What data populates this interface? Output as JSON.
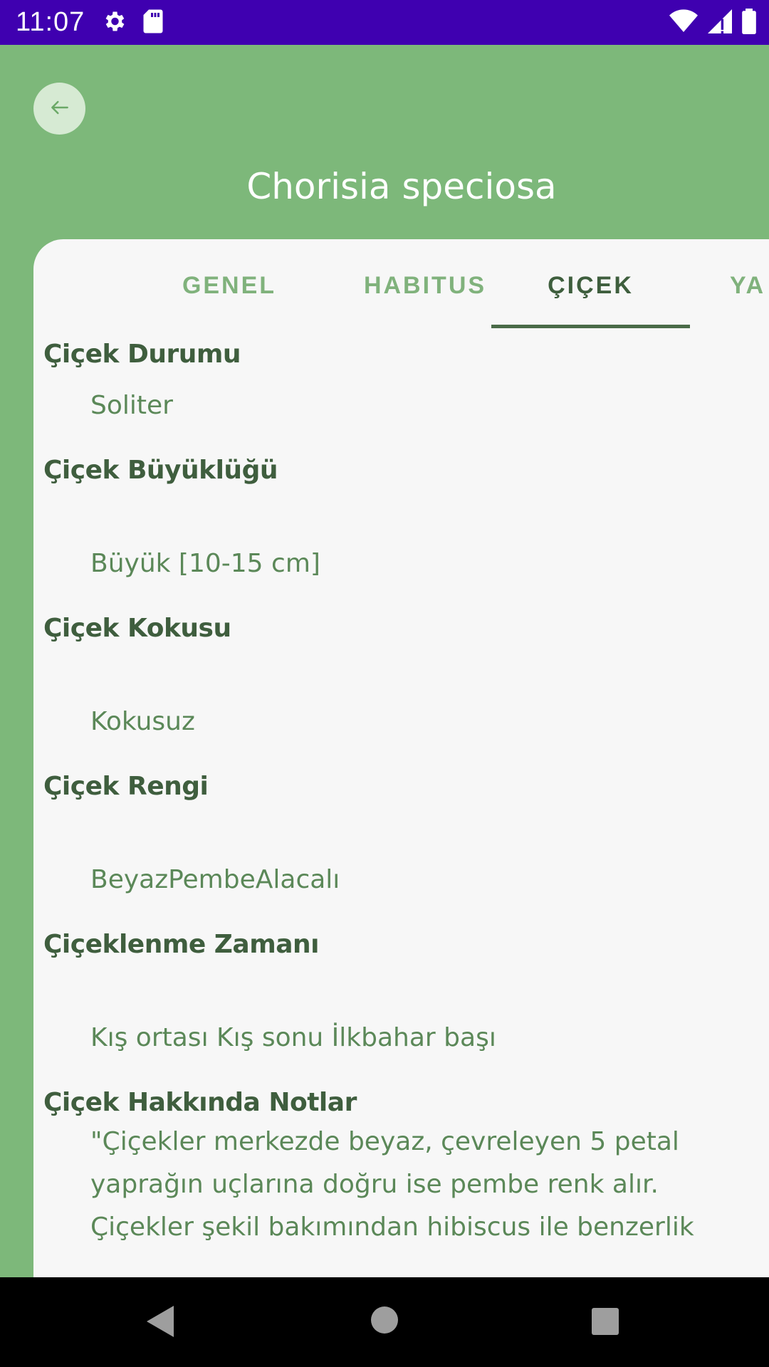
{
  "status_bar": {
    "time": "11:07",
    "left_icons": [
      "gear-icon",
      "sd-card-icon"
    ],
    "right_icons": [
      "wifi-icon",
      "signal-icon",
      "battery-icon"
    ]
  },
  "header": {
    "back_icon": "arrow-left-icon",
    "title": "Chorisia speciosa"
  },
  "tabs": [
    {
      "label": "GENEL",
      "active": false
    },
    {
      "label": "HABITUS",
      "active": false
    },
    {
      "label": "ÇIÇEK",
      "active": true
    },
    {
      "label": "YA",
      "active": false
    }
  ],
  "sections": [
    {
      "label": "Çiçek Durumu",
      "value": "Soliter"
    },
    {
      "label": "Çiçek Büyüklüğü",
      "value": "Büyük [10-15 cm]"
    },
    {
      "label": "Çiçek Kokusu",
      "value": "Kokusuz"
    },
    {
      "label": "Çiçek Rengi",
      "value": "BeyazPembeAlacalı"
    },
    {
      "label": "Çiçeklenme Zamanı",
      "value": " Kış ortası Kış sonu İlkbahar başı"
    },
    {
      "label": "Çiçek Hakkında Notlar",
      "value": "\"Çiçekler merkezde beyaz, çevreleyen 5 petal yaprağın uçlarına doğru ise pembe renk alır. Çiçekler şekil bakımından hibiscus ile benzerlik"
    }
  ],
  "nav_bar": {
    "icons": [
      "back-triangle-icon",
      "home-circle-icon",
      "recents-square-icon"
    ]
  },
  "colors": {
    "status_bar": "#3f00b0",
    "header_green": "#7db87a",
    "card": "#f7f7f7",
    "label_dark_green": "#3f5e3e",
    "value_green": "#5b8858",
    "tab_inactive": "#80b27c"
  }
}
